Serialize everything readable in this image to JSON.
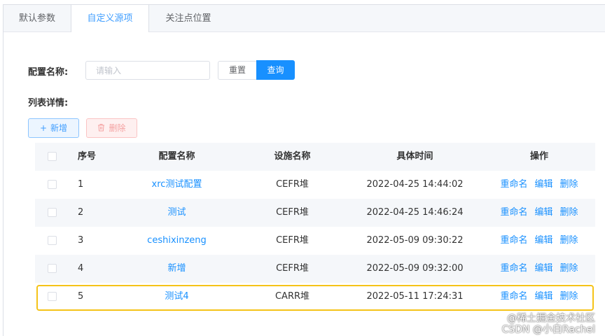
{
  "tabs": [
    "默认参数",
    "自定义源项",
    "关注点位置"
  ],
  "search": {
    "label": "配置名称:",
    "placeholder": "请输入",
    "reset_label": "重置",
    "query_label": "查询"
  },
  "list": {
    "label": "列表详情:",
    "add_label": "新增",
    "add_icon": "+",
    "delete_label": "删除",
    "delete_icon": "🗑"
  },
  "table": {
    "headers": [
      "序号",
      "配置名称",
      "设施名称",
      "具体时间",
      "操作"
    ],
    "rows": [
      {
        "idx": "1",
        "name": "xrc测试配置",
        "facility": "CEFR堆",
        "time": "2022-04-25 14:44:02"
      },
      {
        "idx": "2",
        "name": "测试",
        "facility": "CEFR堆",
        "time": "2022-04-25 14:46:24"
      },
      {
        "idx": "3",
        "name": "ceshixinzeng",
        "facility": "CEFR堆",
        "time": "2022-05-09 09:30:22"
      },
      {
        "idx": "4",
        "name": "新增",
        "facility": "CEFR堆",
        "time": "2022-05-09 09:32:00"
      },
      {
        "idx": "5",
        "name": "测试4",
        "facility": "CARR堆",
        "time": "2022-05-11 17:24:31"
      }
    ],
    "ops": [
      "重命名",
      "编辑",
      "删除"
    ]
  },
  "watermark": {
    "line1": "@稀土掘金技术社区",
    "line2": "CSDN @小白Rachel"
  },
  "colors": {
    "accent": "#1890ff",
    "highlight": "#f5c318",
    "danger_bg": "#fef0f0"
  }
}
